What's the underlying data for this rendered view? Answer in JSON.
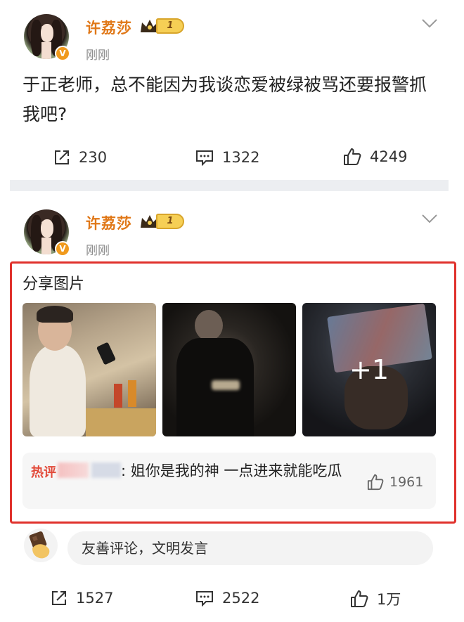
{
  "posts": [
    {
      "username": "许荔莎",
      "level": "1",
      "timestamp": "刚刚",
      "text": "于正老师，总不能因为我谈恋爱被绿被骂还要报警抓我吧?",
      "stats": {
        "reposts": "230",
        "comments": "1322",
        "likes": "4249"
      }
    },
    {
      "username": "许荔莎",
      "level": "1",
      "timestamp": "刚刚",
      "share_title": "分享图片",
      "photos": [
        {
          "name": "photo-man-with-phone"
        },
        {
          "name": "photo-dark-room-phone"
        },
        {
          "name": "photo-tablet-screen",
          "overlay": "+1"
        }
      ],
      "hot_comment": {
        "tag": "热评",
        "text": ": 姐你是我的神 一点进来就能吃瓜",
        "likes": "1961"
      },
      "comment_placeholder": "友善评论，文明发言",
      "stats": {
        "reposts": "1527",
        "comments": "2522",
        "likes": "1万"
      }
    }
  ],
  "colors": {
    "username": "#e07818",
    "highlight_frame": "#e0312c",
    "verified_badge": "#f09a1d"
  },
  "icons": [
    "chevron-down-icon",
    "repost-icon",
    "comment-icon",
    "like-icon",
    "crown-icon",
    "verified-icon"
  ]
}
